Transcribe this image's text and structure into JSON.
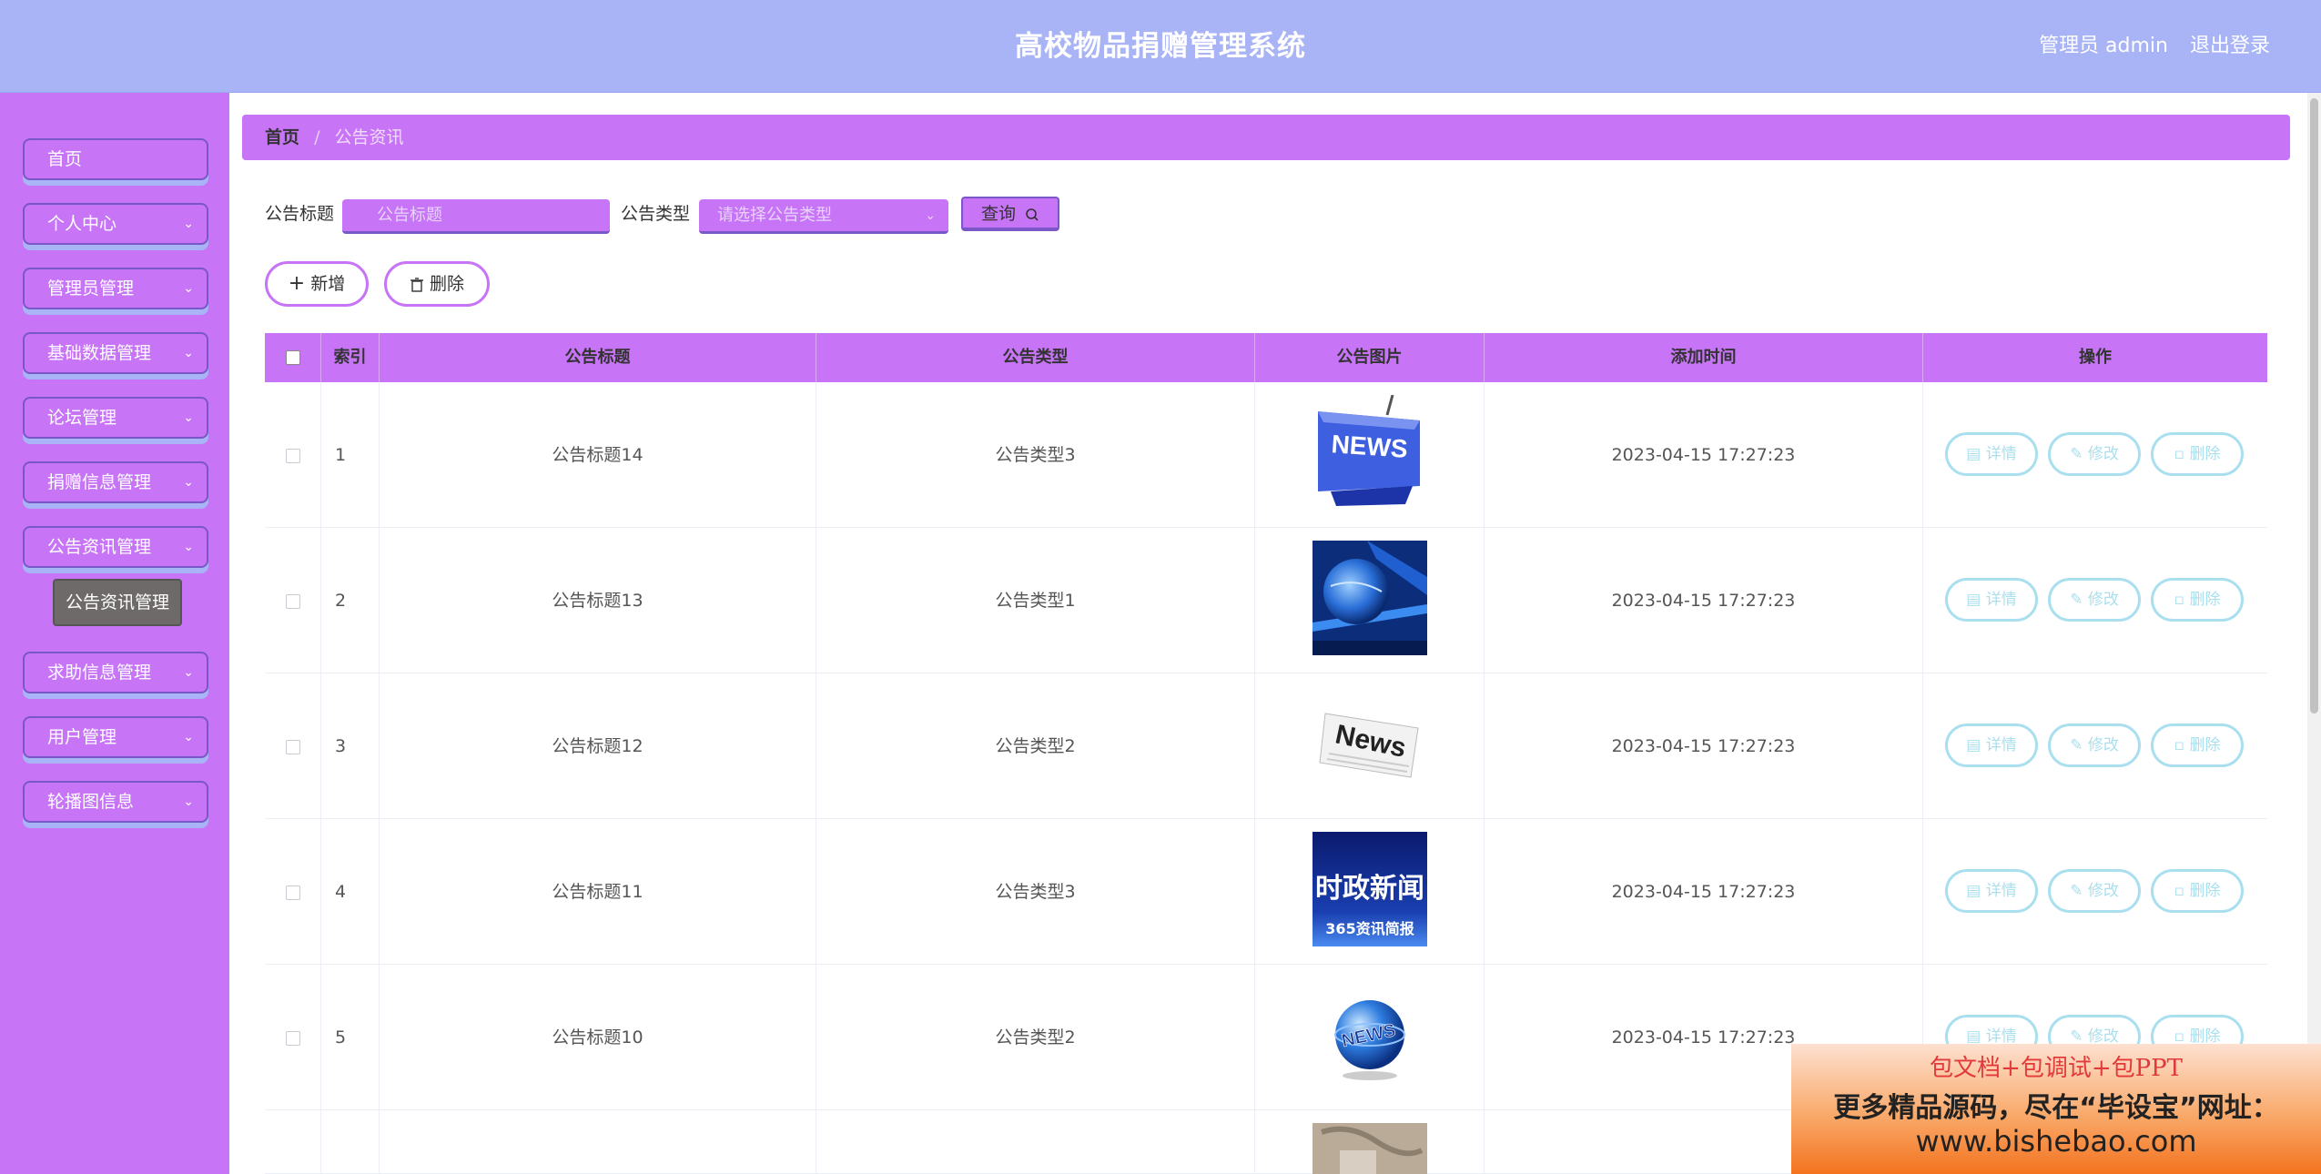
{
  "header": {
    "title": "高校物品捐赠管理系统",
    "user": "管理员 admin",
    "logout": "退出登录"
  },
  "sidebar": {
    "items": [
      {
        "label": "首页",
        "has_children": false
      },
      {
        "label": "个人中心",
        "has_children": true
      },
      {
        "label": "管理员管理",
        "has_children": true
      },
      {
        "label": "基础数据管理",
        "has_children": true
      },
      {
        "label": "论坛管理",
        "has_children": true
      },
      {
        "label": "捐赠信息管理",
        "has_children": true
      },
      {
        "label": "公告资讯管理",
        "has_children": true
      },
      {
        "label": "求助信息管理",
        "has_children": true
      },
      {
        "label": "用户管理",
        "has_children": true
      },
      {
        "label": "轮播图信息",
        "has_children": true
      }
    ],
    "active_sub": "公告资讯管理"
  },
  "breadcrumb": {
    "home": "首页",
    "current": "公告资讯"
  },
  "search": {
    "title_label": "公告标题",
    "title_placeholder": "公告标题",
    "type_label": "公告类型",
    "type_placeholder": "请选择公告类型",
    "query_label": "查询"
  },
  "actions": {
    "add": "新增",
    "delete": "删除"
  },
  "table": {
    "columns": [
      "索引",
      "公告标题",
      "公告类型",
      "公告图片",
      "添加时间",
      "操作"
    ],
    "rows": [
      {
        "index": "1",
        "title": "公告标题14",
        "type": "公告类型3",
        "image": "news-key",
        "time": "2023-04-15 17:27:23"
      },
      {
        "index": "2",
        "title": "公告标题13",
        "type": "公告类型1",
        "image": "globe-tech",
        "time": "2023-04-15 17:27:23"
      },
      {
        "index": "3",
        "title": "公告标题12",
        "type": "公告类型2",
        "image": "newspaper",
        "time": "2023-04-15 17:27:23"
      },
      {
        "index": "4",
        "title": "公告标题11",
        "type": "公告类型3",
        "image": "political-news",
        "time": "2023-04-15 17:27:23"
      },
      {
        "index": "5",
        "title": "公告标题10",
        "type": "公告类型2",
        "image": "news-globe",
        "time": "2023-04-15 17:27:23"
      },
      {
        "index": "",
        "title": "",
        "type": "",
        "image": "partial",
        "time": ""
      }
    ],
    "row_actions": {
      "detail": "详情",
      "edit": "修改",
      "delete": "删除"
    },
    "image_text": {
      "news": "NEWS",
      "news_mixed": "News",
      "political_line1": "时政新闻",
      "political_line2": "365资讯简报"
    }
  },
  "promo": {
    "line1": "包文档+包调试+包PPT",
    "line2": "更多精品源码，尽在“毕设宝”网址：",
    "line3": "www.bishebao.com"
  },
  "colors": {
    "header": "#a9b4f6",
    "sidebar": "#c774f7",
    "accent": "#c774f7",
    "action_outline": "#a9dfef"
  }
}
